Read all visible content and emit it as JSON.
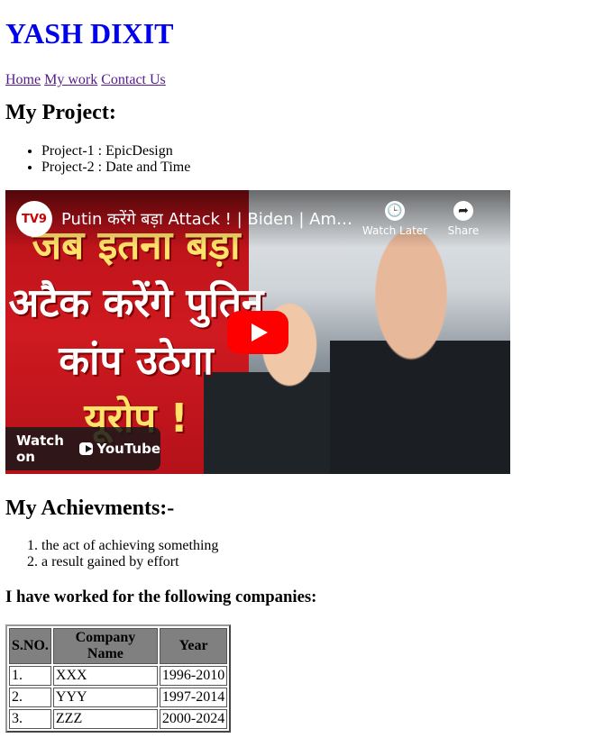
{
  "header": {
    "title": "YASH DIXIT"
  },
  "nav": {
    "links": [
      "Home",
      "My work",
      "Contact Us"
    ]
  },
  "projects": {
    "heading": "My Project:",
    "items": [
      "Project-1 : EpicDesign",
      "Project-2 : Date and Time"
    ]
  },
  "video": {
    "channel_logo": "TV9",
    "title": "Putin करेंगे बड़ा Attack ! | Biden | America...",
    "watch_later": "Watch Later",
    "share": "Share",
    "watch_on": "Watch on",
    "youtube": "YouTube",
    "thumbnail_text": [
      "जब इतना बड़ा",
      "अटैक करेंगे पुतिन",
      "कांप उठेगा",
      "यूरोप !"
    ]
  },
  "achievements": {
    "heading": "My Achievments:-",
    "items": [
      "the act of achieving something",
      "a result gained by effort"
    ]
  },
  "companies": {
    "heading": "I have worked for the following companies:",
    "columns": [
      "S.NO.",
      "Company Name",
      "Year"
    ],
    "rows": [
      [
        "1.",
        "XXX",
        "1996-2010"
      ],
      [
        "2.",
        "YYY",
        "1997-2014"
      ],
      [
        "3.",
        "ZZZ",
        "2000-2024"
      ]
    ]
  },
  "colors": {
    "title": "#0000ee",
    "visited_link": "#551a8b",
    "table_header": "#808080",
    "play_button": "#ff0000"
  }
}
